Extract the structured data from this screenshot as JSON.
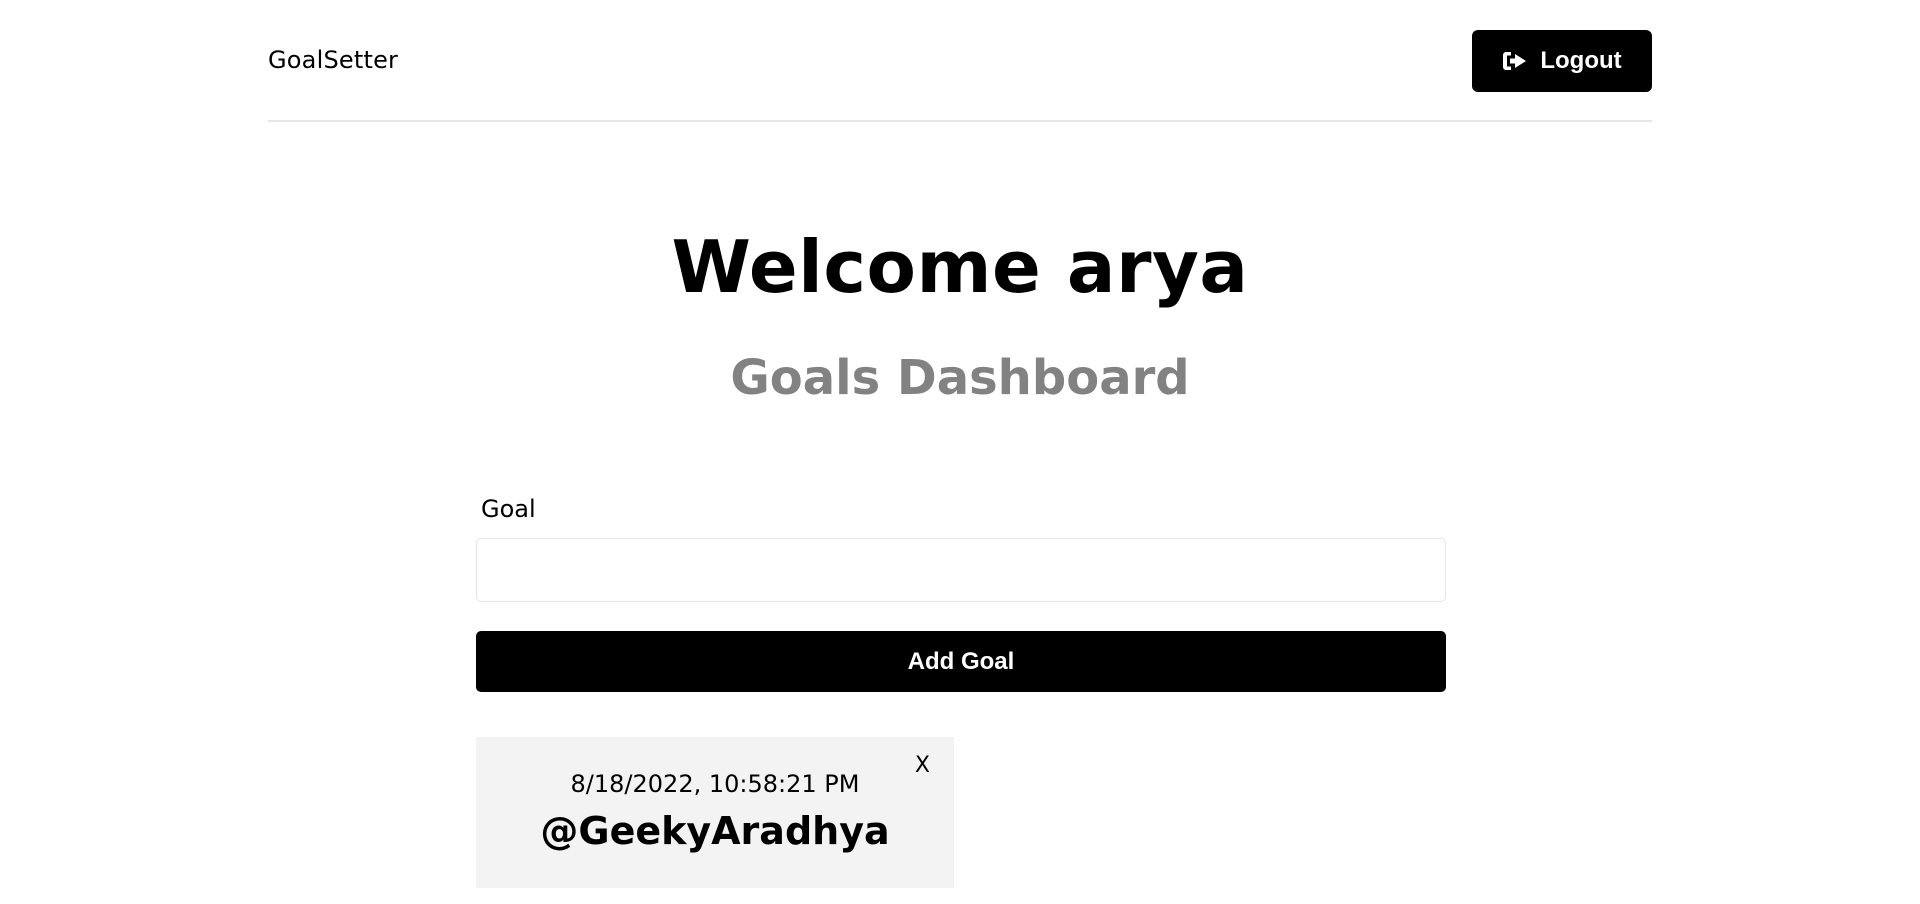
{
  "header": {
    "logo": "GoalSetter",
    "logout_label": "Logout",
    "logout_icon": "sign-out-icon"
  },
  "hero": {
    "welcome": "Welcome arya",
    "subtitle": "Goals Dashboard"
  },
  "form": {
    "goal_label": "Goal",
    "goal_value": "",
    "add_label": "Add Goal"
  },
  "goals": [
    {
      "date": "8/18/2022, 10:58:21 PM",
      "text": "@GeekyAradhya",
      "close_label": "X"
    }
  ]
}
